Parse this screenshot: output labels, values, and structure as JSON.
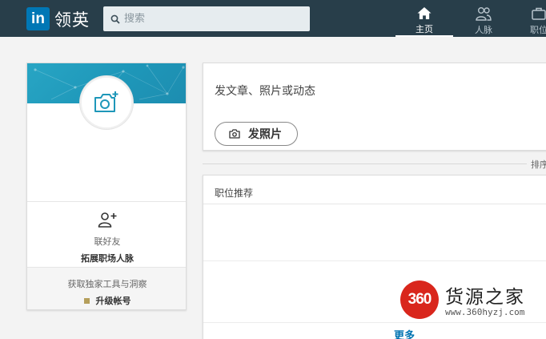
{
  "header": {
    "logo_mark": "in",
    "logo_text": "领英",
    "search_placeholder": "搜索",
    "nav": [
      {
        "label": "主页",
        "icon": "home-icon",
        "active": true
      },
      {
        "label": "人脉",
        "icon": "people-icon",
        "active": false
      },
      {
        "label": "职位",
        "icon": "briefcase-icon",
        "active": false
      }
    ]
  },
  "profile": {
    "avatar_icon": "add-photo-icon",
    "connect_icon": "add-person-icon",
    "connect_label": "联好友",
    "connect_action": "拓展职场人脉",
    "upgrade_hint": "获取独家工具与洞察",
    "upgrade_link": "升级帐号"
  },
  "share": {
    "prompt": "发文章、照片或动态",
    "photo_button": "发照片"
  },
  "feed": {
    "sort_label": "排序",
    "jobs_title": "职位推荐",
    "more_link": "更多"
  },
  "watermark": {
    "badge": "360",
    "name": "货源之家",
    "url": "www.360hyzj.com"
  },
  "colors": {
    "nav_bg": "#283e4a",
    "brand_blue": "#0077b5",
    "banner_teal": "#1e97b9",
    "link_blue": "#0073b1",
    "watermark_red": "#d9261c",
    "premium_gold": "#b59f5b"
  }
}
